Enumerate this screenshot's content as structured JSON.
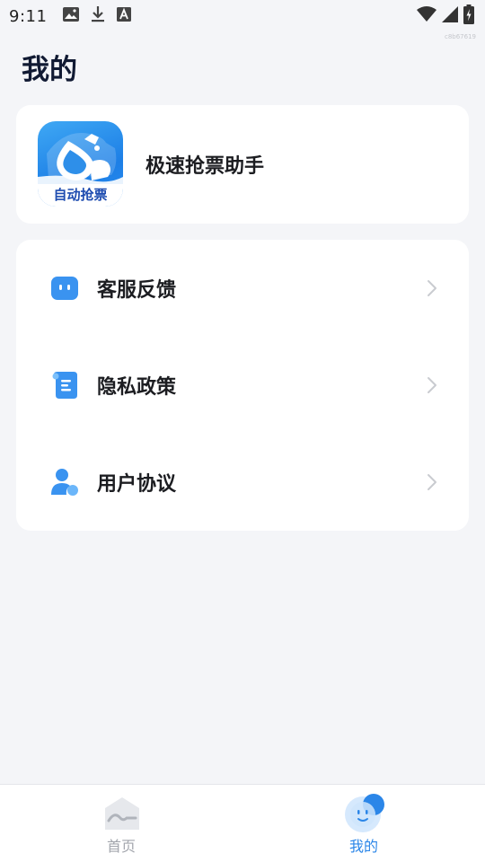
{
  "status_bar": {
    "time": "9:11",
    "left_icons": [
      "image-icon",
      "download-icon",
      "font-icon"
    ],
    "right_icons": [
      "wifi-icon",
      "signal-icon",
      "battery-icon"
    ],
    "build_tag": "c8b67619"
  },
  "page": {
    "title": "我的"
  },
  "app_card": {
    "logo_label": "自动抢票",
    "app_name": "极速抢票助手"
  },
  "menu": {
    "items": [
      {
        "label": "客服反馈",
        "icon": "chat-bubble-icon"
      },
      {
        "label": "隐私政策",
        "icon": "document-icon"
      },
      {
        "label": "用户协议",
        "icon": "user-icon"
      }
    ]
  },
  "bottom_nav": {
    "tabs": [
      {
        "label": "首页",
        "icon": "home-icon",
        "active": false
      },
      {
        "label": "我的",
        "icon": "mine-face-icon",
        "active": true
      }
    ]
  },
  "colors": {
    "background": "#f4f5f8",
    "accent": "#2b86e8",
    "title": "#111a33",
    "inactive_nav": "#a3a6ad"
  }
}
